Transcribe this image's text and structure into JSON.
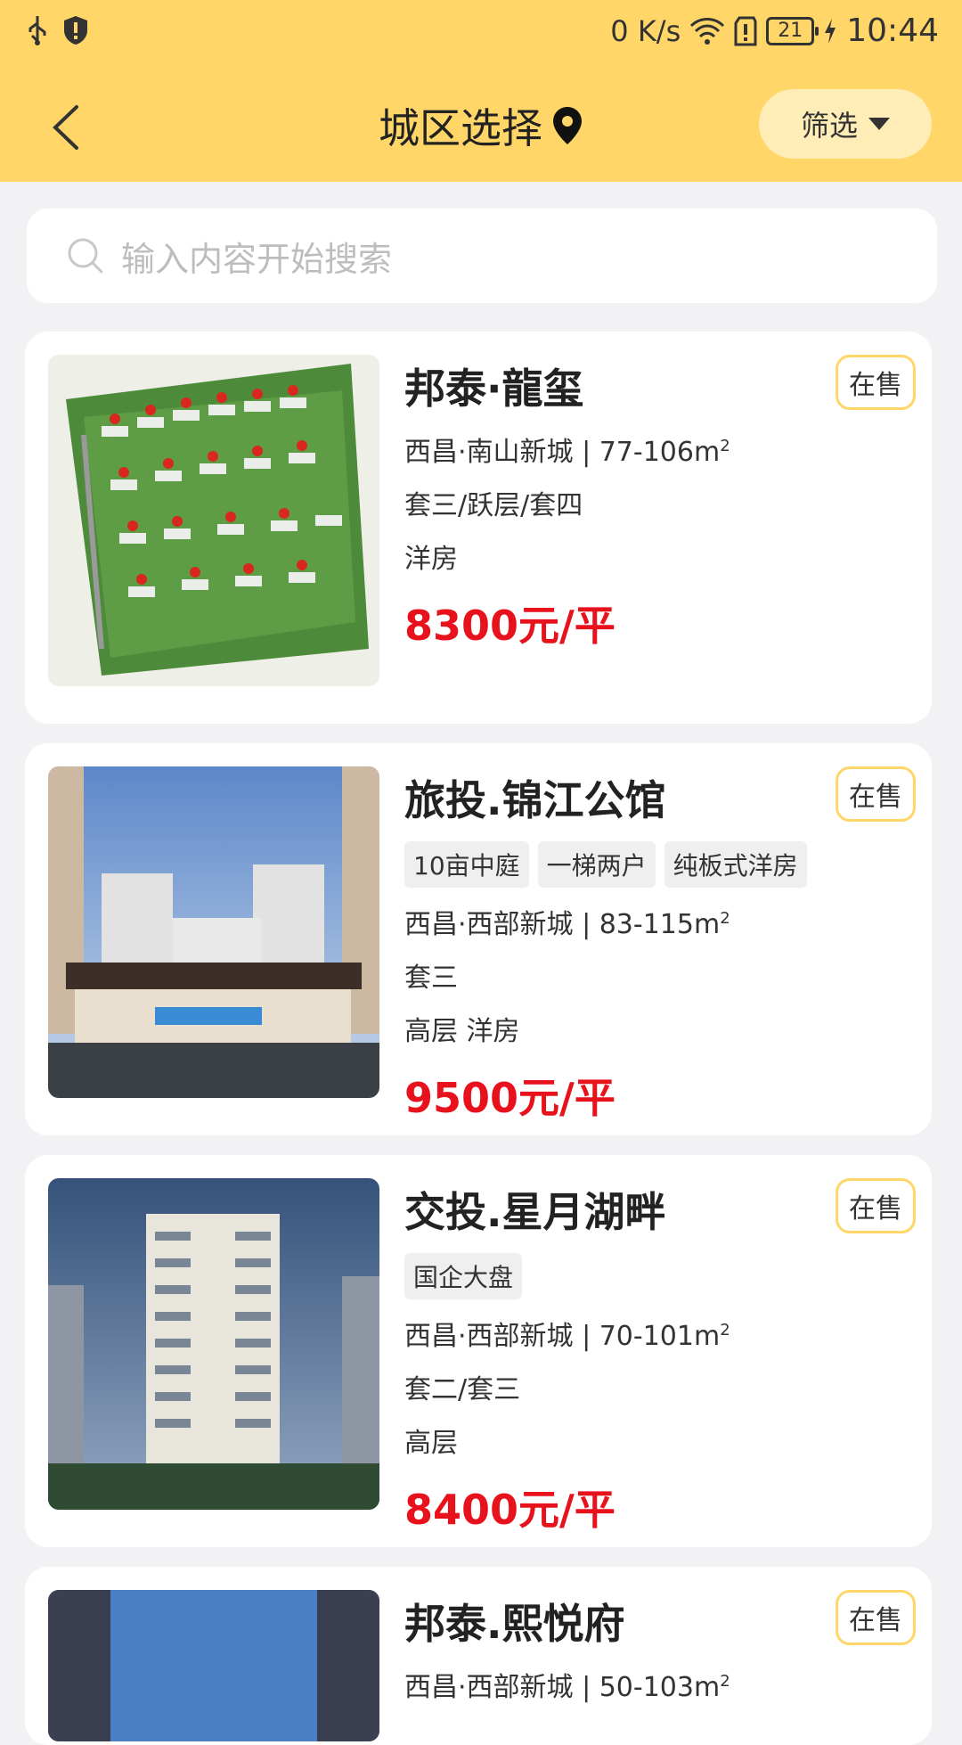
{
  "status": {
    "net": "0 K/s",
    "battery": "21",
    "time": "10:44"
  },
  "header": {
    "title": "城区选择",
    "filter_label": "筛选"
  },
  "search": {
    "placeholder": "输入内容开始搜索"
  },
  "colors": {
    "header_bg": "#ffd667",
    "price": "#e8121c",
    "badge_border": "#ffd667"
  },
  "listings": [
    {
      "name": "邦泰·龍玺",
      "status": "在售",
      "location": "西昌·南山新城 | 77-106m",
      "unit_types": "套三/跃层/套四",
      "building_type": "洋房",
      "price": "8300元/平"
    },
    {
      "name": "旅投.锦江公馆",
      "status": "在售",
      "tags": [
        "10亩中庭",
        "一梯两户",
        "纯板式洋房"
      ],
      "location": "西昌·西部新城 | 83-115m",
      "unit_types": "套三",
      "building_type": "高层 洋房",
      "price": "9500元/平"
    },
    {
      "name": "交投.星月湖畔",
      "status": "在售",
      "tags": [
        "国企大盘"
      ],
      "location": "西昌·西部新城 | 70-101m",
      "unit_types": "套二/套三",
      "building_type": "高层",
      "price": "8400元/平"
    },
    {
      "name": "邦泰.熙悦府",
      "status": "在售",
      "location": "西昌·西部新城 | 50-103m"
    }
  ]
}
